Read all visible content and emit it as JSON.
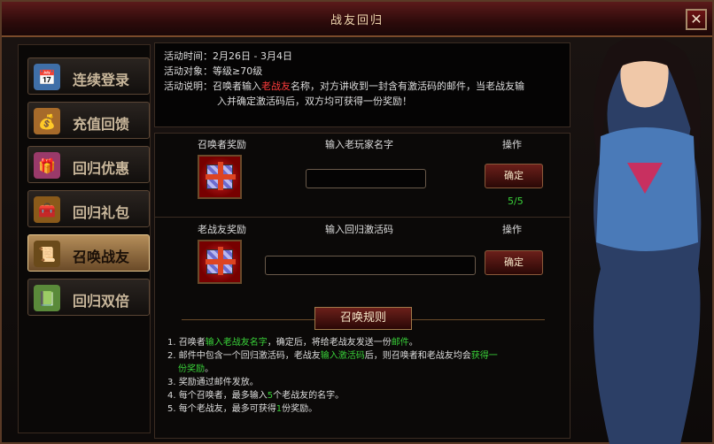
{
  "window": {
    "title": "战友回归",
    "close_label": "✕"
  },
  "sidebar": {
    "items": [
      {
        "label": "连续登录",
        "icon": "calendar-icon",
        "icon_glyph": "📅",
        "icon_bg": "#3f6fa8",
        "active": false
      },
      {
        "label": "充值回馈",
        "icon": "money-bag-icon",
        "icon_glyph": "💰",
        "icon_bg": "#a66a2a",
        "active": false
      },
      {
        "label": "回归优惠",
        "icon": "gift-icon",
        "icon_glyph": "🎁",
        "icon_bg": "#9a3a6a",
        "active": false
      },
      {
        "label": "回归礼包",
        "icon": "treasure-chest-icon",
        "icon_glyph": "🧰",
        "icon_bg": "#8a5a1a",
        "active": false
      },
      {
        "label": "召唤战友",
        "icon": "scroll-icon",
        "icon_glyph": "📜",
        "icon_bg": "#6a4a1a",
        "active": true
      },
      {
        "label": "回归双倍",
        "icon": "exp-scroll-icon",
        "icon_glyph": "📗",
        "icon_bg": "#5a8a3a",
        "active": false
      }
    ]
  },
  "info": {
    "time_label": "活动时间：",
    "time_value": "2月26日 - 3月4日",
    "target_label": "活动对象：",
    "target_value": "等级≥70级",
    "desc_label": "活动说明：",
    "desc_part1": "召唤者输入",
    "desc_highlight": "老战友",
    "desc_part2": "名称，对方讲收到一封含有激活码的邮件，当老战友输",
    "desc_line2": "入并确定激活码后，双方均可获得一份奖励！"
  },
  "summon": {
    "reward_header": "召唤者奖励",
    "input_header": "输入老玩家名字",
    "action_header": "操作",
    "input_value": "",
    "confirm_label": "确定",
    "count": "5/5"
  },
  "veteran": {
    "reward_header": "老战友奖励",
    "input_header": "输入回归激活码",
    "action_header": "操作",
    "input_value": "",
    "confirm_label": "确定"
  },
  "rules": {
    "title": "召唤规则",
    "r1_a": "1. 召唤者",
    "r1_b": "输入老战友名字",
    "r1_c": "，确定后，将给老战友发送一份",
    "r1_d": "邮件",
    "r1_e": "。",
    "r2_a": "2. 邮件中包含一个回归激活码，老战友",
    "r2_b": "输入激活码",
    "r2_c": "后，则召唤者和老战友均会",
    "r2_d": "获得一",
    "r2_e": "份奖励",
    "r2_f": "。",
    "r3": "3. 奖励通过邮件发放。",
    "r4_a": "4. 每个召唤者，最多输入",
    "r4_b": "5",
    "r4_c": "个老战友的名字。",
    "r5_a": "5. 每个老战友，最多可获得",
    "r5_b": "1",
    "r5_c": "份奖励。"
  }
}
